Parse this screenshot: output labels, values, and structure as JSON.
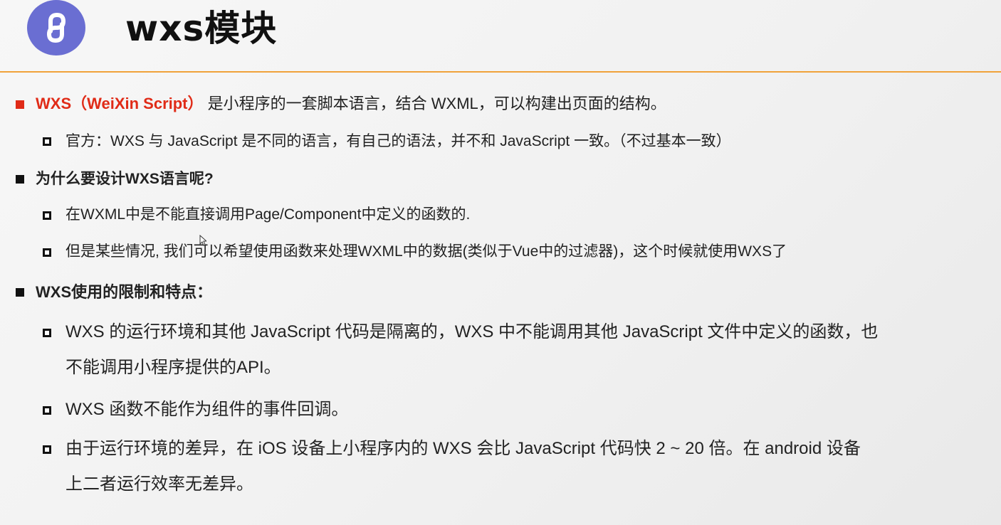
{
  "slide": {
    "title": "wxs模块",
    "logo_icon": "mini-program-logo-icon",
    "accent_color": "#f0a23a",
    "highlight_color": "#e02b17",
    "logo_color": "#6a6ed2"
  },
  "bullets": {
    "intro": {
      "highlight": "WXS（WeiXin Script）",
      "text": "是小程序的一套脚本语言，结合 WXML，可以构建出页面的结构。",
      "sub": "官方：WXS 与 JavaScript 是不同的语言，有自己的语法，并不和 JavaScript 一致。（不过基本一致）"
    },
    "why": {
      "heading": "为什么要设计WXS语言呢?",
      "items": [
        "在WXML中是不能直接调用Page/Component中定义的函数的.",
        "但是某些情况, 我们可以希望使用函数来处理WXML中的数据(类似于Vue中的过滤器)，这个时候就使用WXS了"
      ]
    },
    "limits": {
      "heading": "WXS使用的限制和特点：",
      "items": [
        {
          "line1": "WXS 的运行环境和其他 JavaScript 代码是隔离的，WXS 中不能调用其他 JavaScript 文件中定义的函数，也",
          "line2": "不能调用小程序提供的API。"
        },
        {
          "line1": "WXS 函数不能作为组件的事件回调。"
        },
        {
          "line1": "由于运行环境的差异，在 iOS 设备上小程序内的 WXS 会比 JavaScript 代码快 2 ~ 20 倍。在 android 设备",
          "line2": "上二者运行效率无差异。"
        }
      ]
    }
  }
}
